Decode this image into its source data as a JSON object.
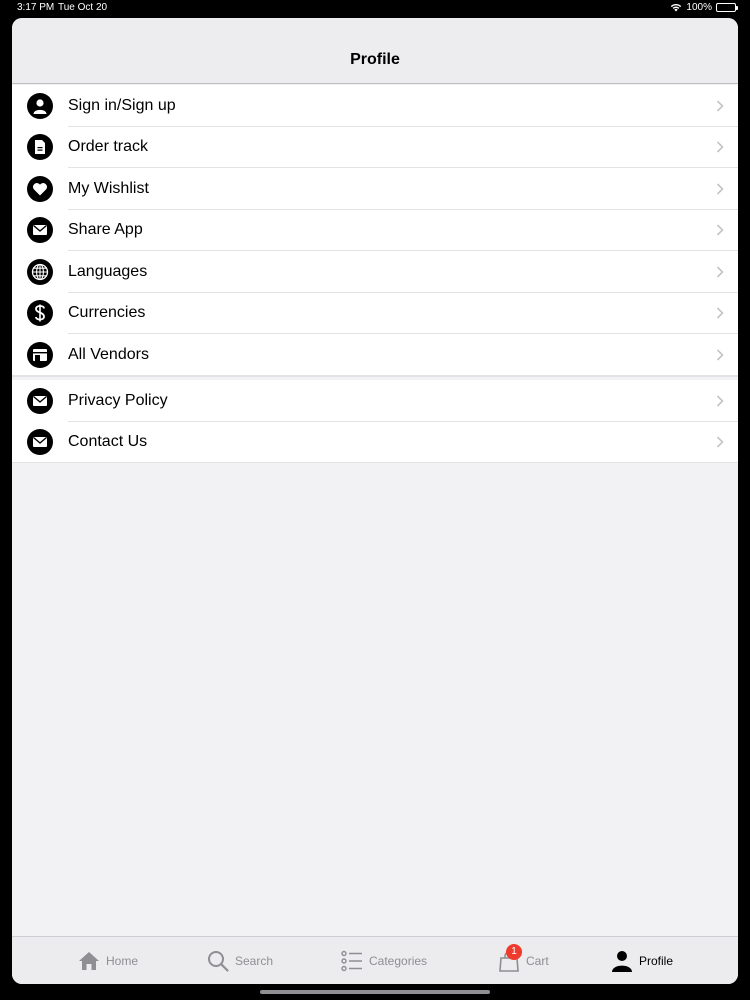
{
  "status": {
    "time": "3:17 PM",
    "date": "Tue Oct 20",
    "battery": "100%"
  },
  "nav": {
    "title": "Profile"
  },
  "menu": {
    "group1": [
      {
        "label": "Sign in/Sign up",
        "icon": "user-icon"
      },
      {
        "label": "Order track",
        "icon": "document-icon"
      },
      {
        "label": "My Wishlist",
        "icon": "heart-icon"
      },
      {
        "label": "Share App",
        "icon": "envelope-icon"
      },
      {
        "label": "Languages",
        "icon": "globe-icon"
      },
      {
        "label": "Currencies",
        "icon": "dollar-icon"
      },
      {
        "label": "All Vendors",
        "icon": "store-icon"
      }
    ],
    "group2": [
      {
        "label": "Privacy Policy",
        "icon": "envelope-icon"
      },
      {
        "label": "Contact Us",
        "icon": "envelope-icon"
      }
    ]
  },
  "tabs": {
    "home": "Home",
    "search": "Search",
    "categories": "Categories",
    "cart": "Cart",
    "cart_badge": "1",
    "profile": "Profile",
    "active": "profile"
  },
  "colors": {
    "badge": "#ef3a2e",
    "inactive_tab": "#8e8e93",
    "background": "#f2f1f4"
  }
}
